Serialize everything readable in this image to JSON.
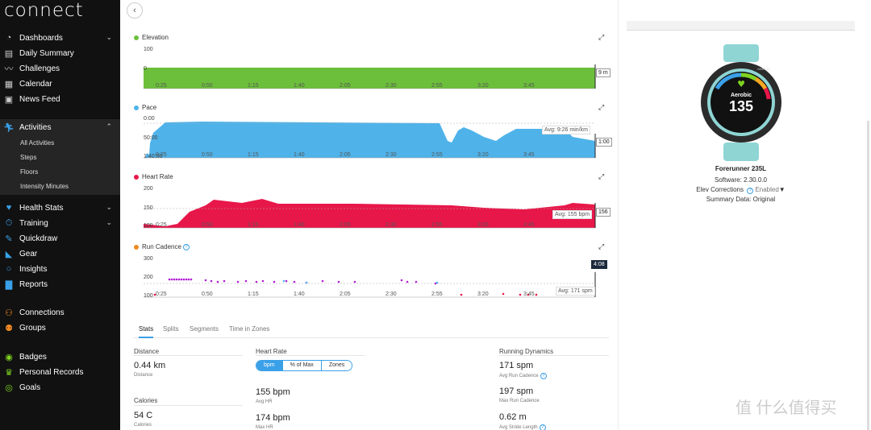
{
  "app": {
    "logo": "connect"
  },
  "sidebar": {
    "items": [
      {
        "label": "Dashboards",
        "icon": "dashboard-icon",
        "chev": "❯"
      },
      {
        "label": "Daily Summary",
        "icon": "calendar-day-icon"
      },
      {
        "label": "Challenges",
        "icon": "challenges-icon"
      },
      {
        "label": "Calendar",
        "icon": "calendar-icon"
      },
      {
        "label": "News Feed",
        "icon": "news-icon"
      },
      {
        "label": "Activities",
        "icon": "runner-icon",
        "chev": "❮"
      },
      {
        "label": "Health Stats",
        "icon": "heart-icon",
        "chev": "❯"
      },
      {
        "label": "Training",
        "icon": "stopwatch-icon",
        "chev": "❯"
      },
      {
        "label": "Quickdraw",
        "icon": "quickdraw-icon"
      },
      {
        "label": "Gear",
        "icon": "shoe-icon"
      },
      {
        "label": "Insights",
        "icon": "lightbulb-icon"
      },
      {
        "label": "Reports",
        "icon": "bar-chart-icon"
      },
      {
        "label": "Connections",
        "icon": "connections-icon"
      },
      {
        "label": "Groups",
        "icon": "groups-icon"
      },
      {
        "label": "Badges",
        "icon": "badge-icon"
      },
      {
        "label": "Personal Records",
        "icon": "trophy-icon"
      },
      {
        "label": "Goals",
        "icon": "goal-icon"
      }
    ],
    "activities_sub": [
      "All Activities",
      "Steps",
      "Floors",
      "Intensity Minutes"
    ]
  },
  "topbar": {
    "back": "‹"
  },
  "charts": {
    "elevation": {
      "label": "Elevation",
      "color": "#6cbf3b",
      "yticks": [
        "100",
        "0"
      ],
      "end_value": "9 m"
    },
    "pace": {
      "label": "Pace",
      "color": "#4fb3ea",
      "yticks": [
        "0:00",
        "50:00",
        "1:40:00"
      ],
      "avg": "Avg: 9:26 min/km",
      "end_value": "1:00"
    },
    "heart_rate": {
      "label": "Heart Rate",
      "color": "#e8174a",
      "yticks": [
        "200",
        "150",
        "100"
      ],
      "avg": "Avg: 155 bpm",
      "end_value": "156"
    },
    "run_cadence": {
      "label": "Run Cadence",
      "color": "#f08a24",
      "yticks": [
        "300",
        "200",
        "100"
      ],
      "avg": "Avg: 171 spm",
      "end_value": "4:08"
    },
    "x_ticks": [
      "0:25",
      "0:50",
      "1:15",
      "1:40",
      "2:05",
      "2:30",
      "2:55",
      "3:20",
      "3:45"
    ]
  },
  "stats": {
    "tabs": [
      "Stats",
      "Splits",
      "Segments",
      "Time in Zones"
    ],
    "distance": {
      "title": "Distance",
      "value": "0.44 km",
      "sub": "Distance"
    },
    "calories": {
      "title": "Calories",
      "value": "54 C",
      "sub": "Calories"
    },
    "heart_rate": {
      "title": "Heart Rate",
      "toggle": [
        "bpm",
        "% of Max",
        "Zones"
      ],
      "avg_value": "155 bpm",
      "avg_sub": "Avg HR",
      "max_value": "174 bpm",
      "max_sub": "Max HR"
    },
    "running_dynamics": {
      "title": "Running Dynamics",
      "avg_cadence": "171 spm",
      "avg_cadence_sub": "Avg Run Cadence",
      "max_cadence": "197 spm",
      "max_cadence_sub": "Max Run Cadence",
      "stride": "0.62 m",
      "stride_sub": "Avg Stride Length"
    }
  },
  "device": {
    "watch_brand": "GARMIN",
    "watch_mode": "Aerobic",
    "watch_value": "135",
    "name": "Forerunner 235L",
    "software_label": "Software:",
    "software": "2.30.0.0",
    "elev_label": "Elev Corrections",
    "elev_value": "Enabled",
    "summary_label": "Summary Data:",
    "summary_value": "Original"
  },
  "watermark": "值 什么值得买"
}
